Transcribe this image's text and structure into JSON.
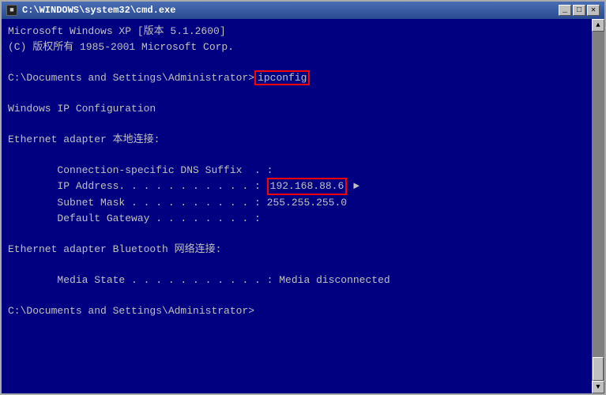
{
  "window": {
    "title": "C:\\WINDOWS\\system32\\cmd.exe",
    "title_icon": "■",
    "buttons": {
      "minimize": "_",
      "maximize": "□",
      "close": "✕"
    }
  },
  "terminal": {
    "line1": "Microsoft Windows XP [版本 5.1.2600]",
    "line2": "(C) 版权所有 1985-2001 Microsoft Corp.",
    "line3": "",
    "line4_prefix": "C:\\Documents and Settings\\Administrator>",
    "line4_cmd": "ipconfig",
    "line5": "",
    "line6": "Windows IP Configuration",
    "line7": "",
    "line8": "Ethernet adapter 本地连接:",
    "line9": "",
    "line10": "        Connection-specific DNS Suffix  . :",
    "line11_prefix": "        IP Address. . . . . . . . . . . : ",
    "line11_value": "192.168.88.6",
    "line12": "        Subnet Mask . . . . . . . . . . : 255.255.255.0",
    "line13": "        Default Gateway . . . . . . . . :",
    "line14": "",
    "line15": "Ethernet adapter Bluetooth 网络连接:",
    "line16": "",
    "line17": "        Media State . . . . . . . . . . . : Media disconnected",
    "line18": "",
    "line19": "C:\\Documents and Settings\\Administrator>"
  },
  "scrollbar": {
    "up_arrow": "▲",
    "down_arrow": "▼"
  }
}
